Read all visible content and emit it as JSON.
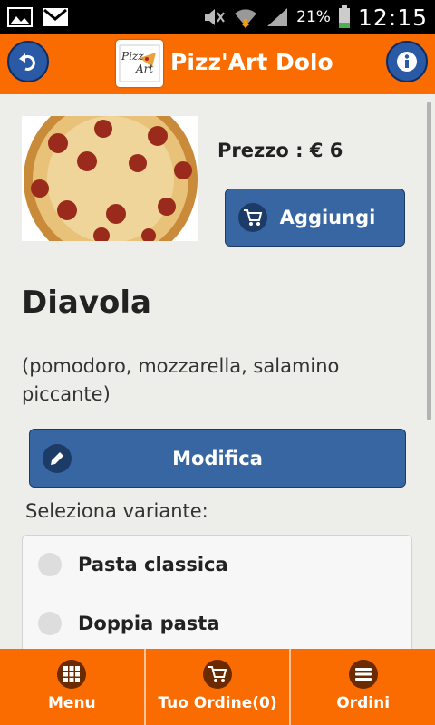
{
  "status_bar": {
    "battery": "21%",
    "time": "12:15"
  },
  "header": {
    "title": "Pizz'Art Dolo",
    "logo_text": "Pizz Art"
  },
  "product": {
    "price_label": "Prezzo : € 6",
    "add_label": "Aggiungi",
    "name": "Diavola",
    "description": "(pomodoro, mozzarella, salamino piccante)",
    "modify_label": "Modifica"
  },
  "variants": {
    "label": "Seleziona variante:",
    "items": [
      {
        "label": "Pasta classica"
      },
      {
        "label": "Doppia pasta"
      }
    ]
  },
  "footer": {
    "tabs": [
      {
        "label": "Menu",
        "icon": "grid-icon"
      },
      {
        "label": "Tuo Ordine(0)",
        "icon": "cart-icon"
      },
      {
        "label": "Ordini",
        "icon": "list-icon"
      }
    ]
  },
  "colors": {
    "accent": "#fa6c00",
    "button": "#3866a3"
  }
}
